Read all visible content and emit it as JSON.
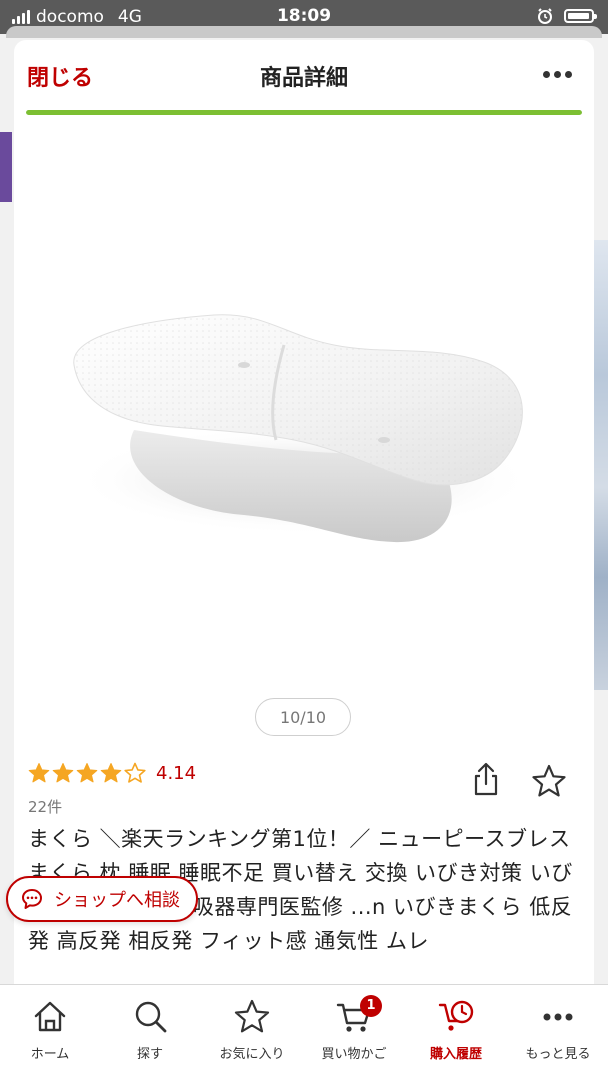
{
  "status_bar": {
    "carrier": "docomo",
    "network": "4G",
    "time": "18:09"
  },
  "header": {
    "close_label": "閉じる",
    "title": "商品詳細",
    "progress_fraction": 1.0,
    "progress_color": "#7cbf32"
  },
  "gallery": {
    "pager": "10/10",
    "image_subject": "white contoured pillow"
  },
  "product": {
    "rating_value": "4.14",
    "star_rating": 4.14,
    "review_count": "22件",
    "title": "まくら ＼楽天ランキング第1位！／ ニューピースブレス まくら 枕 睡眠 睡眠不足 買い替え 交換 いびき対策 いびき プレゼント 呼吸器専門医監修 ...n いびきまくら 低反発 高反発 相反発 フィット感 通気性 ムレ",
    "share_icon": "share-icon",
    "favorite_icon": "star-outline-icon"
  },
  "consult_button": {
    "label": "ショップへ相談",
    "icon": "chat-bubble-icon"
  },
  "tabbar": {
    "items": [
      {
        "label": "ホーム",
        "icon": "home-icon"
      },
      {
        "label": "探す",
        "icon": "search-icon"
      },
      {
        "label": "お気に入り",
        "icon": "star-icon"
      },
      {
        "label": "買い物かご",
        "icon": "cart-icon",
        "badge": "1"
      },
      {
        "label": "購入履歴",
        "icon": "history-icon",
        "active": true
      },
      {
        "label": "もっと見る",
        "icon": "more-icon"
      }
    ]
  },
  "colors": {
    "accent": "#bf0000",
    "star": "#f5a623",
    "progress": "#7cbf32"
  }
}
